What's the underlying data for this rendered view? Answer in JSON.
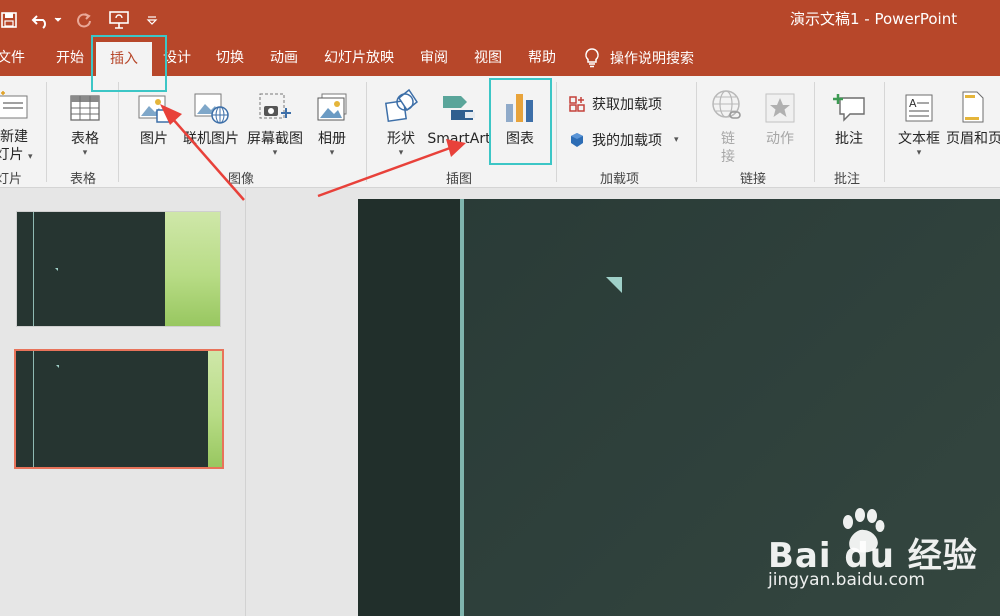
{
  "window": {
    "title": "演示文稿1  -  PowerPoint",
    "accent_color": "#b7472a"
  },
  "quick_access": [
    {
      "name": "save-icon",
      "interactable": true
    },
    {
      "name": "undo-icon",
      "interactable": true
    },
    {
      "name": "redo-icon",
      "interactable": true
    },
    {
      "name": "present-from-start-icon",
      "interactable": true
    },
    {
      "name": "customize-toolbar-icon",
      "interactable": true
    }
  ],
  "tabs": [
    {
      "label": "文件"
    },
    {
      "label": "开始"
    },
    {
      "label": "插入",
      "active": true
    },
    {
      "label": "设计"
    },
    {
      "label": "切换"
    },
    {
      "label": "动画"
    },
    {
      "label": "幻灯片放映"
    },
    {
      "label": "审阅"
    },
    {
      "label": "视图"
    },
    {
      "label": "帮助"
    }
  ],
  "tell_me": {
    "label": "操作说明搜索",
    "icon": "lightbulb-icon"
  },
  "ribbon": {
    "slides": {
      "new_slide_line1": "新建",
      "new_slide_line2": "灯片",
      "group": "灯片"
    },
    "tables": {
      "table": "表格",
      "group": "表格"
    },
    "images": {
      "picture": "图片",
      "online_pictures": "联机图片",
      "screenshot": "屏幕截图",
      "photo_album": "相册",
      "group": "图像"
    },
    "illustrations": {
      "shapes": "形状",
      "smartart": "SmartArt",
      "chart": "图表",
      "group": "插图"
    },
    "addins": {
      "get_addins": "获取加载项",
      "my_addins": "我的加载项",
      "group": "加载项"
    },
    "links": {
      "link_line1": "链",
      "link_line2": "接",
      "action": "动作",
      "group": "链接"
    },
    "comments": {
      "comment": "批注",
      "group": "批注"
    },
    "text": {
      "textbox": "文本框",
      "header_footer": "页眉和页"
    }
  },
  "slides_pane": {
    "slides": [
      {
        "index": 1,
        "selected": false
      },
      {
        "index": 2,
        "selected": true
      }
    ],
    "selected_border_color": "#e8735a"
  },
  "annotations": {
    "highlight_color": "#3cc6c6",
    "arrow_color": "#e8413a"
  },
  "watermark": {
    "brand": "Bai du 经验",
    "url": "jingyan.baidu.com"
  }
}
